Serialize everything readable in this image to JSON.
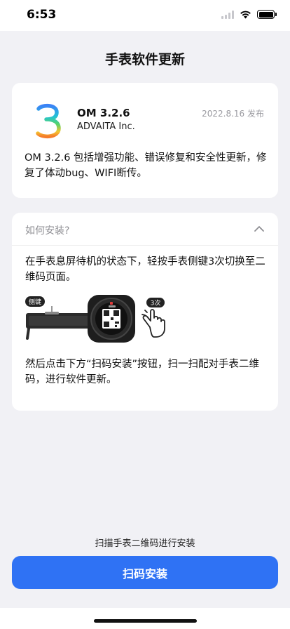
{
  "status_bar": {
    "time": "6:53"
  },
  "page": {
    "title": "手表软件更新"
  },
  "update_card": {
    "logo_glyph": "3",
    "version_name": "OM 3.2.6",
    "developer": "ADVAITA Inc.",
    "release_date": "2022.8.16 发布",
    "description": "OM 3.2.6 包括增强功能、错误修复和安全性更新，修复了体动bug、WIFI断传。"
  },
  "howto_card": {
    "title": "如何安装?",
    "expanded": true,
    "step1": "在手表息屏待机的状态下，轻按手表侧键3次切换至二维码页面。",
    "side_button_badge": "侧键",
    "press_count_badge": "3次",
    "step2": "然后点击下方“扫码安装”按钮，扫一扫配对手表二维码，进行软件更新。"
  },
  "footer": {
    "hint": "扫描手表二维码进行安装",
    "scan_button_label": "扫码安装"
  },
  "colors": {
    "accent": "#2f72f4",
    "background": "#f1f1f5",
    "card": "#ffffff",
    "muted_text": "#8e8e93"
  },
  "icons": [
    "wifi-icon",
    "signal-icon",
    "battery-icon",
    "app-logo-3-icon",
    "chevron-up-icon",
    "hand-tap-icon"
  ]
}
